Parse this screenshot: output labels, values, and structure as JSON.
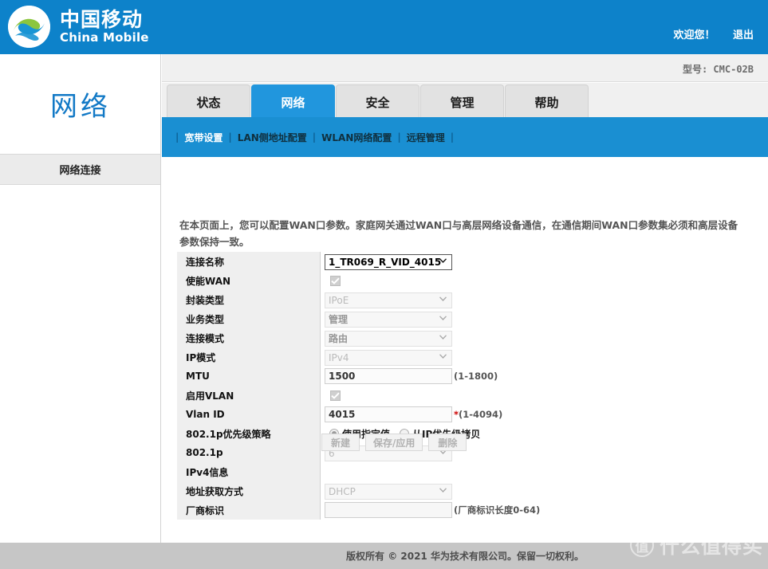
{
  "brand": {
    "logo_icon": "china-mobile-logo-icon",
    "name_cn": "中国移动",
    "name_en": "China Mobile",
    "welcome": "欢迎您！",
    "logout": "退出"
  },
  "model": {
    "text": "型号: CMC-02B"
  },
  "tabs": [
    {
      "label": "状态",
      "active": false
    },
    {
      "label": "网络",
      "active": true
    },
    {
      "label": "安全",
      "active": false
    },
    {
      "label": "管理",
      "active": false
    },
    {
      "label": "帮助",
      "active": false
    }
  ],
  "subnav": [
    {
      "label": "宽带设置",
      "active": true
    },
    {
      "label": "LAN侧地址配置",
      "active": false
    },
    {
      "label": "WLAN网络配置",
      "active": false
    },
    {
      "label": "远程管理",
      "active": false
    }
  ],
  "sidebar": {
    "title": "网络",
    "items": [
      {
        "label": "网络连接",
        "active": true
      }
    ]
  },
  "main": {
    "description": "在本页面上，您可以配置WAN口参数。家庭网关通过WAN口与高层网络设备通信，在通信期间WAN口参数集必须和高层设备参数保持一致。",
    "fields": [
      {
        "label": "连接名称",
        "value": "1_TR069_R_VID_4015",
        "hint": ""
      },
      {
        "label": "使能WAN",
        "value": "",
        "hint": ""
      },
      {
        "label": "封装类型",
        "value": "IPoE",
        "hint": ""
      },
      {
        "label": "业务类型",
        "value": "管理",
        "hint": ""
      },
      {
        "label": "连接模式",
        "value": "路由",
        "hint": ""
      },
      {
        "label": "IP模式",
        "value": "IPv4",
        "hint": ""
      },
      {
        "label": "MTU",
        "value": "1500",
        "hint": "(1-1800)"
      },
      {
        "label": "启用VLAN",
        "value": "",
        "hint": ""
      },
      {
        "label": "Vlan ID",
        "value": "4015",
        "hint": "(1-4094)",
        "required_star": "*"
      },
      {
        "label": "802.1p优先级策略",
        "value": "",
        "hint": ""
      },
      {
        "label": "802.1p",
        "value": "6",
        "hint": ""
      },
      {
        "label": "IPv4信息",
        "value": "",
        "hint": ""
      },
      {
        "label": "地址获取方式",
        "value": "DHCP",
        "hint": ""
      },
      {
        "label": "厂商标识",
        "value": "",
        "hint": "(厂商标识长度0-64)"
      }
    ],
    "radios": [
      {
        "label": "使用指定值",
        "selected": true
      },
      {
        "label": "从IP优先级拷贝",
        "selected": false
      }
    ],
    "buttons": [
      {
        "label": "新建"
      },
      {
        "label": "保存/应用"
      },
      {
        "label": "删除"
      }
    ]
  },
  "footer": {
    "text": "版权所有 © 2021 华为技术有限公司。保留一切权利。"
  },
  "watermark": {
    "mark": "值",
    "text": "什么值得买"
  },
  "colors": {
    "brand_blue": "#0d82ca",
    "tab_active": "#2196dd",
    "subnav_blue": "#1a8fd2",
    "sidebar_title": "#1279c6",
    "footer_bg": "#c6c6c6",
    "required_red": "#cc0000"
  }
}
